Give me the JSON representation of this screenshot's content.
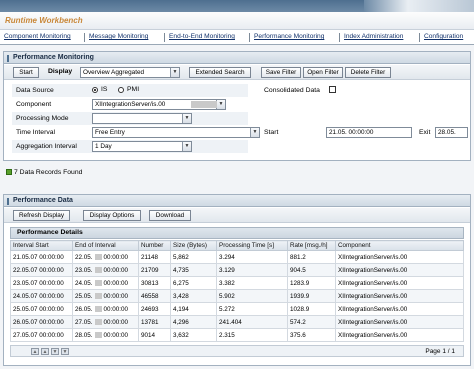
{
  "app": {
    "title": "Runtime Workbench"
  },
  "nav": {
    "tabs": [
      {
        "label": "Component Monitoring"
      },
      {
        "label": "Message Monitoring"
      },
      {
        "label": "End-to-End Monitoring"
      },
      {
        "label": "Performance Monitoring"
      },
      {
        "label": "Index Administration"
      },
      {
        "label": "Configuration"
      }
    ]
  },
  "perf_monitoring": {
    "header": "Performance Monitoring",
    "start_button": "Start",
    "display_label": "Display",
    "display_value": "Overview Aggregated",
    "extended_search": "Extended Search",
    "save_filter": "Save Filter",
    "open_filter": "Open Filter",
    "delete_filter": "Delete Filter",
    "data_source_label": "Data Source",
    "radio_is": "IS",
    "radio_pmi": "PMI",
    "radio_selected": "IS",
    "consolidated_label": "Consolidated Data",
    "consolidated_checked": false,
    "component_label": "Component",
    "component_value": "XIIntegrationServer/is.00",
    "processing_mode_label": "Processing Mode",
    "processing_mode_value": "",
    "time_interval_label": "Time Interval",
    "time_interval_value": "Free Entry",
    "start_label": "Start",
    "start_value": "21.05.          00:00:00",
    "exit_label": "Exit",
    "exit_value": "28.05.",
    "aggregation_label": "Aggregation Interval",
    "aggregation_value": "1 Day"
  },
  "records_found": "7 Data Records Found",
  "perf_data": {
    "header": "Performance Data",
    "refresh_button": "Refresh Display",
    "display_options_button": "Display Options",
    "download_button": "Download",
    "table_title": "Performance Details",
    "columns": [
      "Interval Start",
      "End of Interval",
      "Number",
      "Size (Bytes)",
      "Processing Time [s]",
      "Rate [msg./h]",
      "Component"
    ],
    "rows": [
      {
        "start": "21.05.07 00:00:00",
        "end_date": "22.05.",
        "end_time": "00:00:00",
        "number": "21148",
        "size": "5,862",
        "ptime": "3.294",
        "rate": "881.2",
        "component": "XIIntegrationServer/is.00"
      },
      {
        "start": "22.05.07 00:00:00",
        "end_date": "23.05.",
        "end_time": "00:00:00",
        "number": "21709",
        "size": "4,735",
        "ptime": "3.129",
        "rate": "904.5",
        "component": "XIIntegrationServer/is.00"
      },
      {
        "start": "23.05.07 00:00:00",
        "end_date": "24.05.",
        "end_time": "00:00:00",
        "number": "30813",
        "size": "6,275",
        "ptime": "3.382",
        "rate": "1283.9",
        "component": "XIIntegrationServer/is.00"
      },
      {
        "start": "24.05.07 00:00:00",
        "end_date": "25.05.",
        "end_time": "00:00:00",
        "number": "46558",
        "size": "3,428",
        "ptime": "5.902",
        "rate": "1939.9",
        "component": "XIIntegrationServer/is.00"
      },
      {
        "start": "25.05.07 00:00:00",
        "end_date": "26.05.",
        "end_time": "00:00:00",
        "number": "24693",
        "size": "4,194",
        "ptime": "5.272",
        "rate": "1028.9",
        "component": "XIIntegrationServer/is.00"
      },
      {
        "start": "26.05.07 00:00:00",
        "end_date": "27.05.",
        "end_time": "00:00:00",
        "number": "13781",
        "size": "4,296",
        "ptime": "241.404",
        "rate": "574.2",
        "component": "XIIntegrationServer/is.00"
      },
      {
        "start": "27.05.07 00:00:00",
        "end_date": "28.05.",
        "end_time": "00:00:00",
        "number": "9014",
        "size": "3,632",
        "ptime": "2.315",
        "rate": "375.6",
        "component": "XIIntegrationServer/is.00"
      }
    ],
    "page_info": "Page 1 / 1"
  },
  "colors": {
    "accent": "#4e6f8f",
    "title": "#c9883a",
    "link": "#10306a",
    "success": "#5aa02c"
  }
}
